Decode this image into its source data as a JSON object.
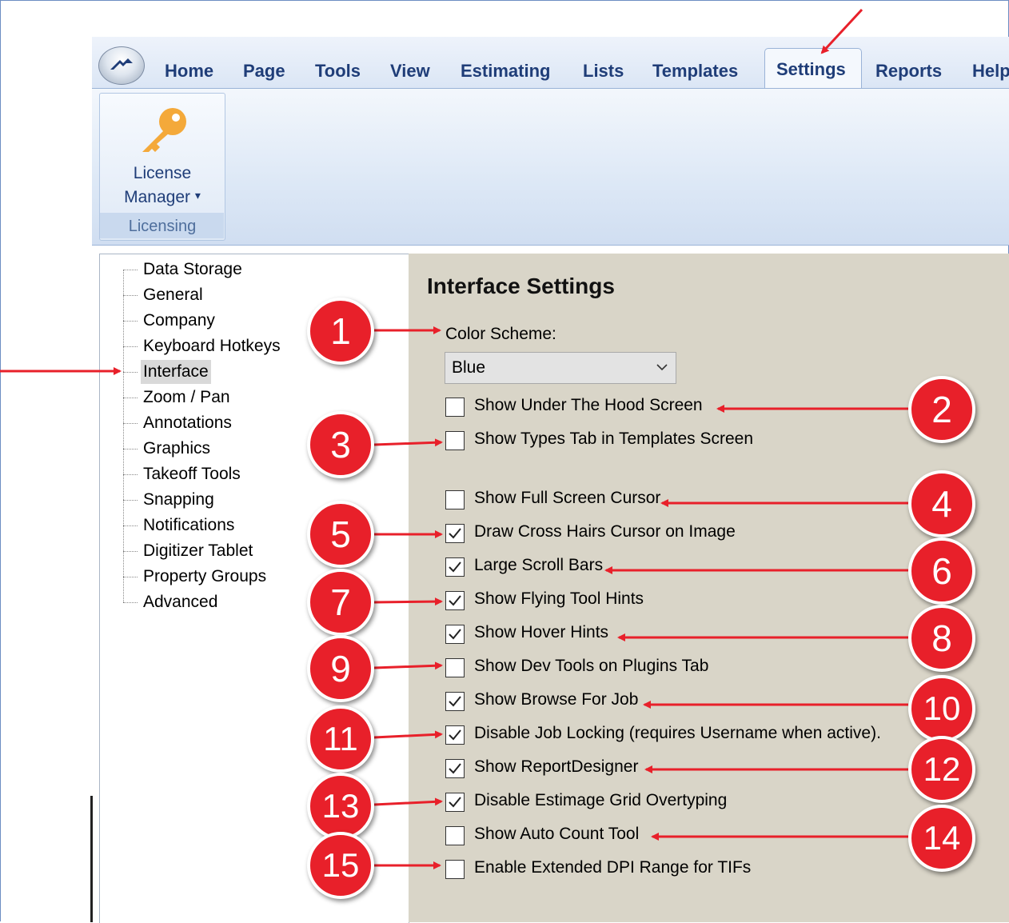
{
  "ribbon": {
    "tabs": [
      "Home",
      "Page",
      "Tools",
      "View",
      "Estimating",
      "Lists",
      "Templates",
      "Settings",
      "Reports",
      "Help"
    ],
    "active_tab": "Settings",
    "group": {
      "button_label_line1": "License",
      "button_label_line2": "Manager",
      "dropdown_glyph": "▾",
      "label": "Licensing",
      "icon": "key-icon"
    }
  },
  "tree": {
    "items": [
      "Data Storage",
      "General",
      "Company",
      "Keyboard Hotkeys",
      "Interface",
      "Zoom / Pan",
      "Annotations",
      "Graphics",
      "Takeoff Tools",
      "Snapping",
      "Notifications",
      "Digitizer Tablet",
      "Property Groups",
      "Advanced"
    ],
    "selected": "Interface"
  },
  "panel": {
    "title": "Interface Settings",
    "color_scheme_label": "Color Scheme:",
    "color_scheme_value": "Blue",
    "options": [
      {
        "label": "Show Under The Hood Screen",
        "checked": false
      },
      {
        "label": "Show Types Tab in Templates Screen",
        "checked": false
      },
      {
        "label": "Show Full Screen Cursor",
        "checked": false
      },
      {
        "label": "Draw Cross Hairs Cursor on Image",
        "checked": true
      },
      {
        "label": "Large Scroll Bars",
        "checked": true
      },
      {
        "label": "Show Flying Tool Hints",
        "checked": true
      },
      {
        "label": "Show Hover Hints",
        "checked": true
      },
      {
        "label": "Show Dev Tools on Plugins Tab",
        "checked": false
      },
      {
        "label": "Show Browse For Job",
        "checked": true
      },
      {
        "label": "Disable Job Locking (requires Username when active).",
        "checked": true
      },
      {
        "label": "Show ReportDesigner",
        "checked": true
      },
      {
        "label": "Disable Estimage Grid Overtyping",
        "checked": true
      },
      {
        "label": "Show Auto Count Tool",
        "checked": false
      },
      {
        "label": "Enable Extended DPI Range for TIFs",
        "checked": false
      }
    ]
  },
  "annotations": {
    "badges": [
      "1",
      "2",
      "3",
      "4",
      "5",
      "6",
      "7",
      "8",
      "9",
      "10",
      "11",
      "12",
      "13",
      "14",
      "15"
    ],
    "arrow_color": "#e8202a"
  }
}
